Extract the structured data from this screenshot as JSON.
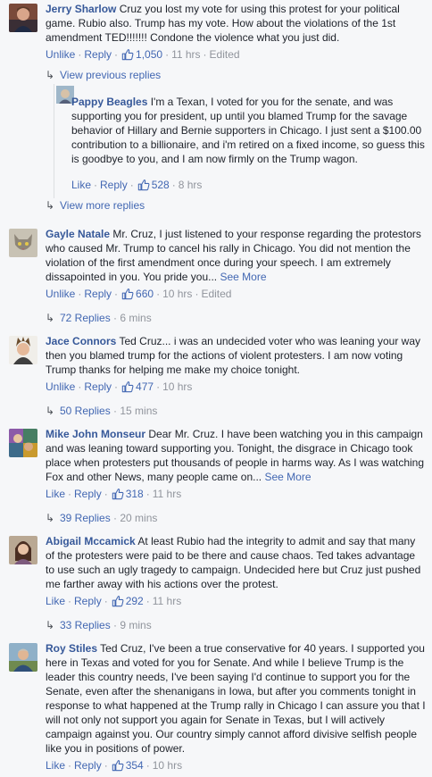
{
  "comments": [
    {
      "author": "Jerry Sharlow",
      "text": "Cruz you lost my vote for using this protest for your political game. Rubio also. Trump has my vote. How about the violations of the 1st amendment TED!!!!!!! Condone the violence what you just did.",
      "like_label": "Unlike",
      "reply_label": "Reply",
      "likes": "1,050",
      "time": "11 hrs",
      "edited": "Edited",
      "view_previous": "View previous replies",
      "view_more": "View more replies",
      "reply": {
        "author": "Pappy Beagles",
        "text": "I'm a Texan, I voted for you for the senate, and was supporting you for president, up until you blamed Trump for the savage behavior of Hillary and Bernie supporters in Chicago. I just sent a $100.00 contribution to a billionaire, and i'm retired on a fixed income, so guess this is goodbye to you, and I am now firmly on the Trump wagon.",
        "like_label": "Like",
        "reply_label": "Reply",
        "likes": "528",
        "time": "8 hrs"
      }
    },
    {
      "author": "Gayle Natale",
      "text": "Mr. Cruz, I just listened to your response regarding the protestors who caused Mr. Trump to cancel his rally in Chicago. You did not mention the violation of the first amendment once during your speech. I am extremely dissapointed in you. You pride you...",
      "see_more": "See More",
      "like_label": "Unlike",
      "reply_label": "Reply",
      "likes": "660",
      "time": "10 hrs",
      "edited": "Edited",
      "replies": "72 Replies",
      "replies_time": "6 mins"
    },
    {
      "author": "Jace Connors",
      "text": "Ted Cruz... i was an undecided voter who was leaning your way then you blamed trump for the actions of violent protesters. I am now voting Trump thanks for helping me make my choice tonight.",
      "like_label": "Unlike",
      "reply_label": "Reply",
      "likes": "477",
      "time": "10 hrs",
      "replies": "50 Replies",
      "replies_time": "15 mins"
    },
    {
      "author": "Mike John Monseur",
      "text": "Dear Mr. Cruz. I have been watching you in this campaign and was leaning toward supporting you. Tonight, the disgrace in Chicago took place when protesters put thousands of people in harms way. As I was watching Fox and other News, many people came on...",
      "see_more": "See More",
      "like_label": "Like",
      "reply_label": "Reply",
      "likes": "318",
      "time": "11 hrs",
      "replies": "39 Replies",
      "replies_time": "20 mins"
    },
    {
      "author": "Abigail Mccamick",
      "text": "At least Rubio had the integrity to admit and say that many of the protesters were paid to be there and cause chaos. Ted takes advantage to use such an ugly tragedy to campaign. Undecided here but Cruz just pushed me farther away with his actions over the protest.",
      "like_label": "Like",
      "reply_label": "Reply",
      "likes": "292",
      "time": "11 hrs",
      "replies": "33 Replies",
      "replies_time": "9 mins"
    },
    {
      "author": "Roy Stiles",
      "text": "Ted Cruz, I've been a true conservative for 40 years. I supported you here in Texas and voted for you for Senate. And while I believe Trump is the leader this country needs, I've been saying I'd continue to support you for the Senate, even after the shenanigans in Iowa, but after you comments tonight in response to what happened at the Trump rally in Chicago I can assure you that I will not only not support you again for Senate in Texas, but I will actively campaign against you. Our country simply cannot afford divisive selfish people like you in positions of power.",
      "like_label": "Like",
      "reply_label": "Reply",
      "likes": "354",
      "time": "10 hrs"
    }
  ],
  "icons": {
    "like": "thumbs-up-icon",
    "reply_arrow": "reply-arrow-icon"
  },
  "colors": {
    "link": "#365899",
    "action": "#4267b2",
    "meta": "#90949c",
    "background": "#f6f7f9"
  }
}
